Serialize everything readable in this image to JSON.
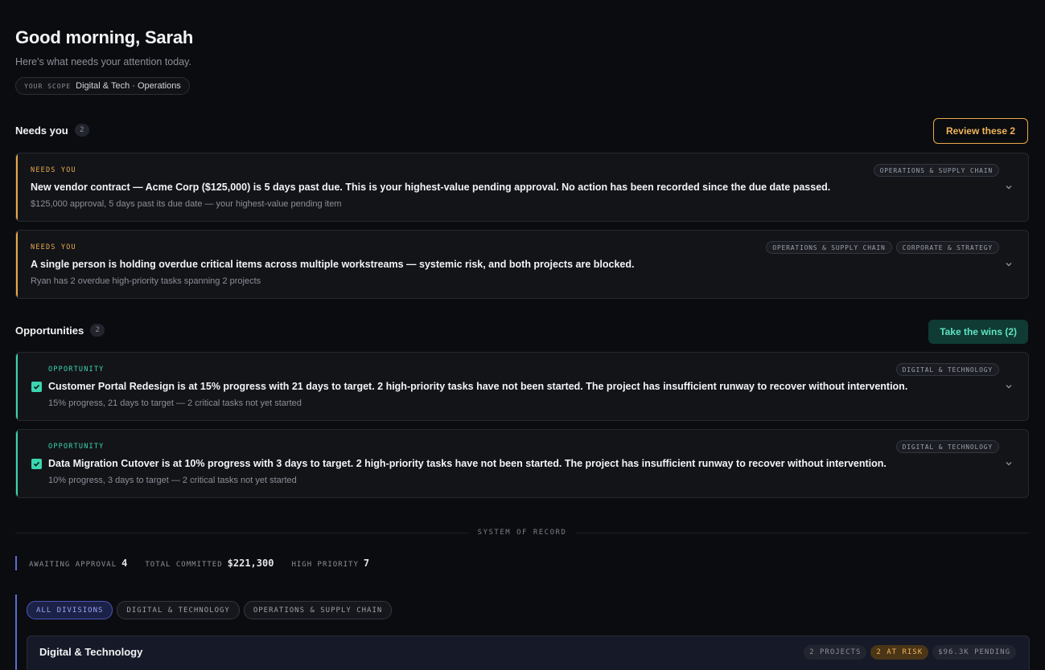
{
  "header": {
    "greeting": "Good morning, Sarah",
    "subtitle": "Here's what needs your attention today.",
    "scope_label": "YOUR SCOPE",
    "scope_value": "Digital & Tech · Operations"
  },
  "needs_you": {
    "title": "Needs you",
    "count": "2",
    "action_label": "Review these 2",
    "items": [
      {
        "kicker": "NEEDS YOU",
        "headline": "New vendor contract — Acme Corp ($125,000) is 5 days past due. This is your highest-value pending approval. No action has been recorded since the due date passed.",
        "detail": "$125,000 approval, 5 days past its due date — your highest-value pending item",
        "tags": [
          "OPERATIONS & SUPPLY CHAIN"
        ]
      },
      {
        "kicker": "NEEDS YOU",
        "headline": "A single person is holding overdue critical items across multiple workstreams — systemic risk, and both projects are blocked.",
        "detail": "Ryan has 2 overdue high-priority tasks spanning 2 projects",
        "tags": [
          "OPERATIONS & SUPPLY CHAIN",
          "CORPORATE & STRATEGY"
        ]
      }
    ]
  },
  "opportunities": {
    "title": "Opportunities",
    "count": "2",
    "action_label": "Take the wins (2)",
    "items": [
      {
        "kicker": "OPPORTUNITY",
        "headline": "Customer Portal Redesign is at 15% progress with 21 days to target. 2 high-priority tasks have not been started. The project has insufficient runway to recover without intervention.",
        "detail": "15% progress, 21 days to target — 2 critical tasks not yet started",
        "tags": [
          "DIGITAL & TECHNOLOGY"
        ],
        "checked": true
      },
      {
        "kicker": "OPPORTUNITY",
        "headline": "Data Migration Cutover is at 10% progress with 3 days to target. 2 high-priority tasks have not been started. The project has insufficient runway to recover without intervention.",
        "detail": "10% progress, 3 days to target — 2 critical tasks not yet started",
        "tags": [
          "DIGITAL & TECHNOLOGY"
        ],
        "checked": true
      }
    ]
  },
  "system_of_record": {
    "label": "SYSTEM OF RECORD",
    "stats": [
      {
        "label": "AWAITING APPROVAL",
        "value": "4"
      },
      {
        "label": "TOTAL COMMITTED",
        "value": "$221,300"
      },
      {
        "label": "HIGH PRIORITY",
        "value": "7"
      }
    ]
  },
  "divisions": {
    "filters": [
      {
        "label": "ALL DIVISIONS",
        "active": true
      },
      {
        "label": "DIGITAL & TECHNOLOGY",
        "active": false
      },
      {
        "label": "OPERATIONS & SUPPLY CHAIN",
        "active": false
      }
    ],
    "cards": [
      {
        "title": "Digital & Technology",
        "badges": [
          "2 PROJECTS",
          "2 AT RISK",
          "$96.3K PENDING"
        ]
      }
    ]
  },
  "colors": {
    "background": "#0b0c0f",
    "needs_accent": "#e9a94b",
    "opportunity_accent": "#3bd6b0",
    "division_accent": "#5b6bd6"
  },
  "icons": {
    "card_toggle": "chevron-down-icon",
    "opportunity_select": "checkbox-checked-icon"
  }
}
